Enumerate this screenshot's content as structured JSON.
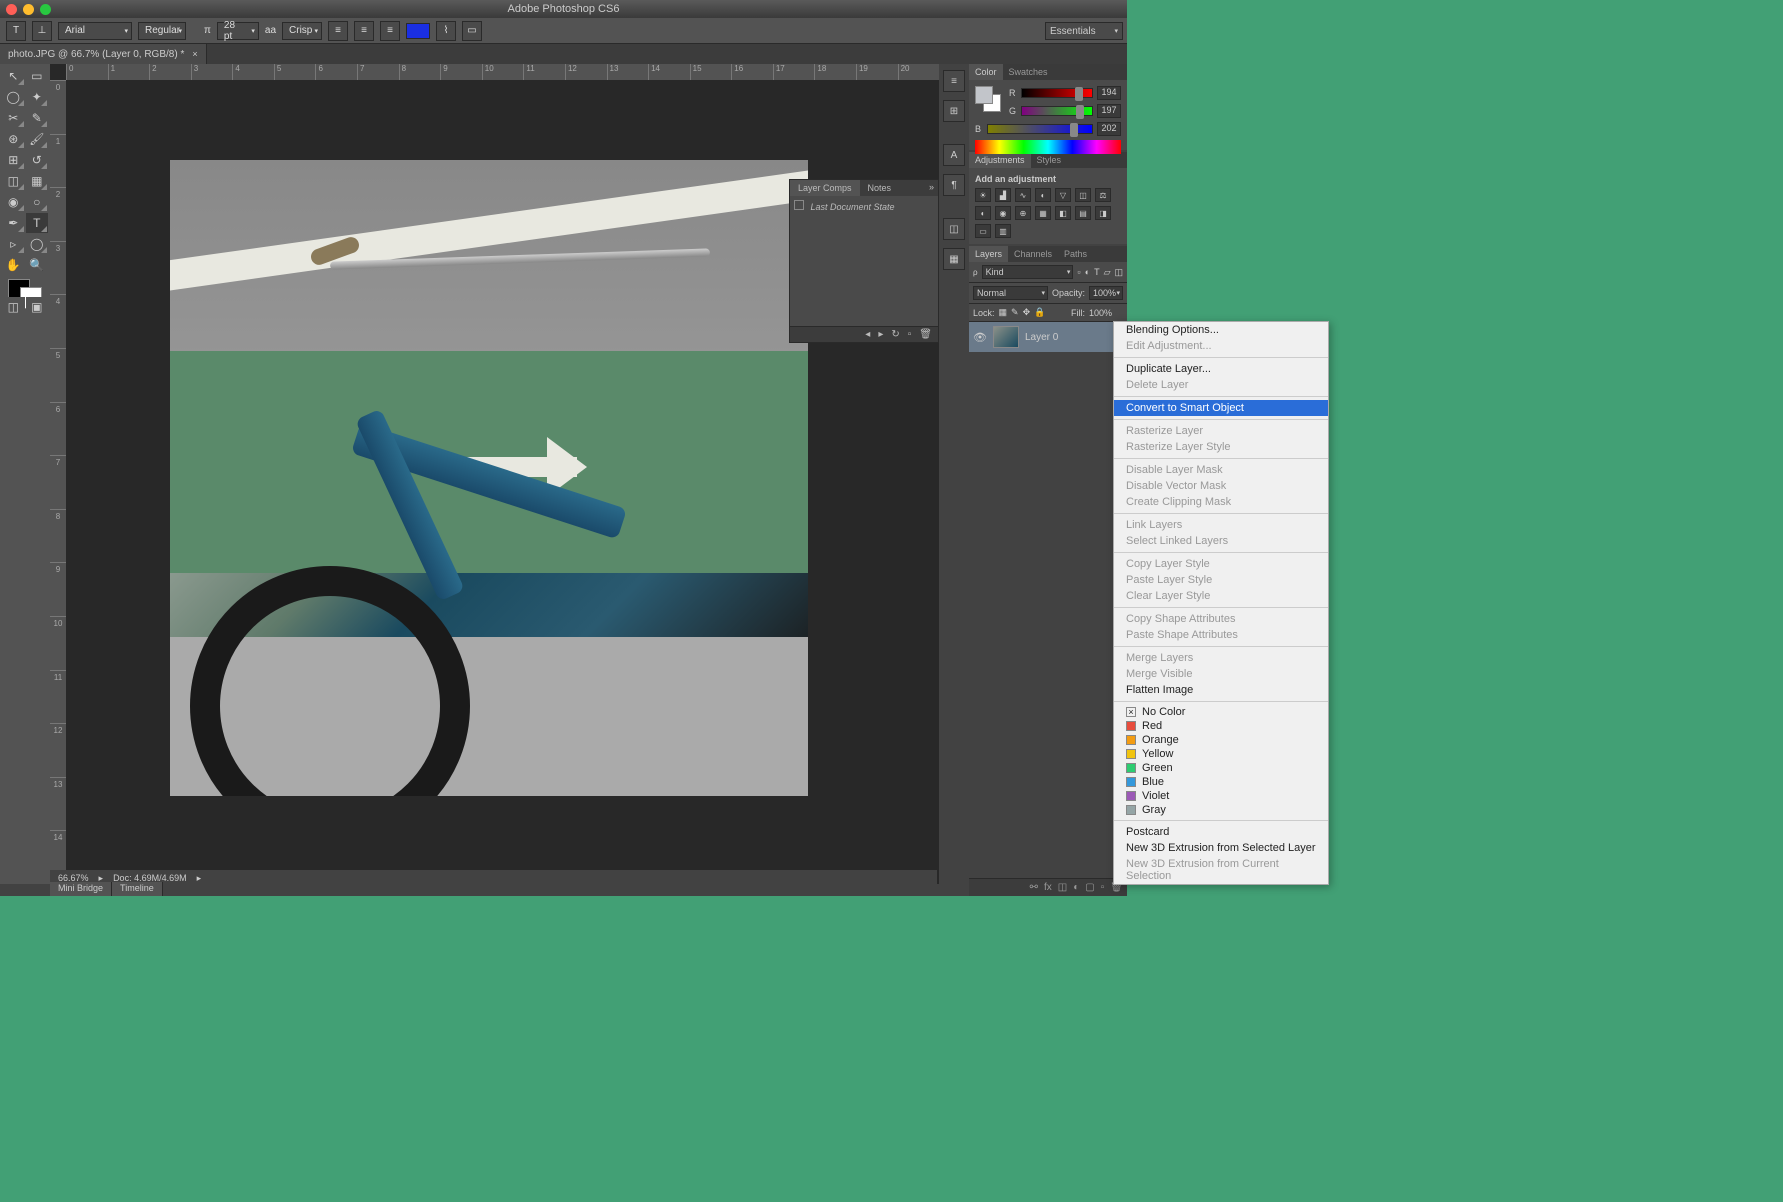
{
  "titlebar": {
    "title": "Adobe Photoshop CS6"
  },
  "workspace": "Essentials",
  "options_bar": {
    "font_family": "Arial",
    "font_style": "Regular",
    "font_size": "28 pt",
    "anti_alias": "Crisp"
  },
  "doc_tab": {
    "label": "photo.JPG @ 66.7% (Layer 0, RGB/8) *"
  },
  "ruler_h": [
    "0",
    "1",
    "2",
    "3",
    "4",
    "5",
    "6",
    "7",
    "8",
    "9",
    "10",
    "11",
    "12",
    "13",
    "14",
    "15",
    "16",
    "17",
    "18",
    "19",
    "20"
  ],
  "ruler_v": [
    "0",
    "1",
    "2",
    "3",
    "4",
    "5",
    "6",
    "7",
    "8",
    "9",
    "10",
    "11",
    "12",
    "13",
    "14"
  ],
  "layer_comps": {
    "tab1": "Layer Comps",
    "tab2": "Notes",
    "state": "Last Document State"
  },
  "panels": {
    "color_tab": "Color",
    "swatches_tab": "Swatches",
    "r_label": "R",
    "r_val": "194",
    "g_label": "G",
    "g_val": "197",
    "b_label": "B",
    "b_val": "202",
    "adjustments_tab": "Adjustments",
    "styles_tab": "Styles",
    "adj_label": "Add an adjustment",
    "layers_tab": "Layers",
    "channels_tab": "Channels",
    "paths_tab": "Paths",
    "kind_label": "Kind",
    "blend_mode": "Normal",
    "opacity_label": "Opacity:",
    "opacity_val": "100%",
    "lock_label": "Lock:",
    "fill_label": "Fill:",
    "fill_val": "100%",
    "layer0_name": "Layer 0"
  },
  "status": {
    "zoom": "66.67%",
    "doc_size": "Doc: 4.69M/4.69M"
  },
  "bottom_tabs": {
    "mini_bridge": "Mini Bridge",
    "timeline": "Timeline"
  },
  "context_menu": {
    "items": [
      {
        "label": "Blending Options...",
        "enabled": true
      },
      {
        "label": "Edit Adjustment...",
        "enabled": false
      },
      {
        "sep": true
      },
      {
        "label": "Duplicate Layer...",
        "enabled": true
      },
      {
        "label": "Delete Layer",
        "enabled": false
      },
      {
        "sep": true
      },
      {
        "label": "Convert to Smart Object",
        "enabled": true,
        "highlighted": true
      },
      {
        "sep": true
      },
      {
        "label": "Rasterize Layer",
        "enabled": false
      },
      {
        "label": "Rasterize Layer Style",
        "enabled": false
      },
      {
        "sep": true
      },
      {
        "label": "Disable Layer Mask",
        "enabled": false
      },
      {
        "label": "Disable Vector Mask",
        "enabled": false
      },
      {
        "label": "Create Clipping Mask",
        "enabled": false
      },
      {
        "sep": true
      },
      {
        "label": "Link Layers",
        "enabled": false
      },
      {
        "label": "Select Linked Layers",
        "enabled": false
      },
      {
        "sep": true
      },
      {
        "label": "Copy Layer Style",
        "enabled": false
      },
      {
        "label": "Paste Layer Style",
        "enabled": false
      },
      {
        "label": "Clear Layer Style",
        "enabled": false
      },
      {
        "sep": true
      },
      {
        "label": "Copy Shape Attributes",
        "enabled": false
      },
      {
        "label": "Paste Shape Attributes",
        "enabled": false
      },
      {
        "sep": true
      },
      {
        "label": "Merge Layers",
        "enabled": false
      },
      {
        "label": "Merge Visible",
        "enabled": false
      },
      {
        "label": "Flatten Image",
        "enabled": true
      },
      {
        "sep": true
      }
    ],
    "colors": [
      {
        "label": "No Color",
        "swatch": "transparent",
        "x": true
      },
      {
        "label": "Red",
        "swatch": "#e74c3c"
      },
      {
        "label": "Orange",
        "swatch": "#f39c12"
      },
      {
        "label": "Yellow",
        "swatch": "#f1c40f"
      },
      {
        "label": "Green",
        "swatch": "#2ecc71"
      },
      {
        "label": "Blue",
        "swatch": "#3498db"
      },
      {
        "label": "Violet",
        "swatch": "#9b59b6"
      },
      {
        "label": "Gray",
        "swatch": "#95a5a6"
      }
    ],
    "bottom": [
      {
        "label": "Postcard",
        "enabled": true
      },
      {
        "label": "New 3D Extrusion from Selected Layer",
        "enabled": true
      },
      {
        "label": "New 3D Extrusion from Current Selection",
        "enabled": false
      }
    ]
  }
}
